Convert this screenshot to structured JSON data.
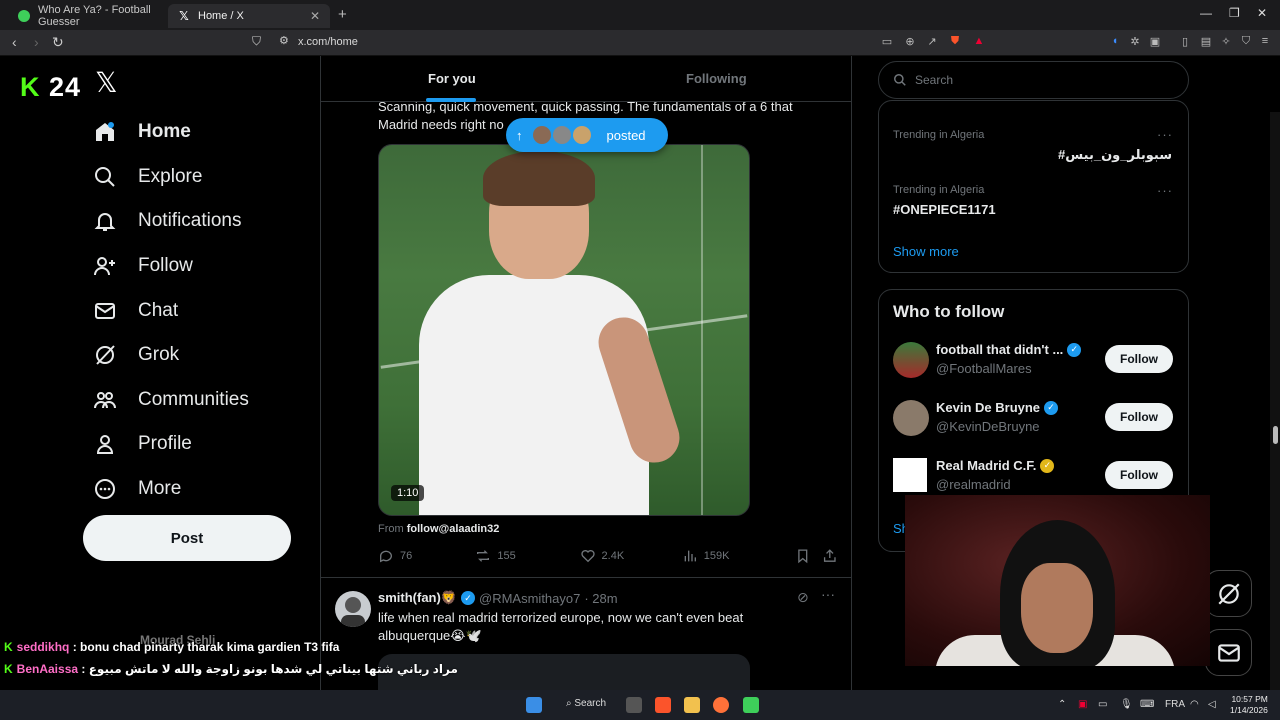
{
  "browser": {
    "tabs": [
      {
        "title": "Who Are Ya? - Football Guesser",
        "favicon": "globe-green-icon"
      },
      {
        "title": "Home / X",
        "favicon": "x-logo-icon"
      }
    ],
    "url": "x.com/home"
  },
  "overlay": {
    "channel_logo": "24"
  },
  "sidebar": {
    "items": [
      {
        "label": "Home",
        "icon": "home-icon"
      },
      {
        "label": "Explore",
        "icon": "search-icon"
      },
      {
        "label": "Notifications",
        "icon": "bell-icon"
      },
      {
        "label": "Follow",
        "icon": "person-add-icon"
      },
      {
        "label": "Chat",
        "icon": "mail-icon"
      },
      {
        "label": "Grok",
        "icon": "grok-icon"
      },
      {
        "label": "Communities",
        "icon": "people-icon"
      },
      {
        "label": "Profile",
        "icon": "person-icon"
      },
      {
        "label": "More",
        "icon": "more-circle-icon"
      }
    ],
    "post_label": "Post"
  },
  "feed": {
    "tabs": [
      "For you",
      "Following"
    ],
    "posted_pill": "posted",
    "tweet1": {
      "text_line1": "Scanning, quick movement, quick passing. The fundamentals of a 6 that",
      "text_line2": "Madrid needs right no",
      "duration": "1:10",
      "from_prefix": "From",
      "from_account": "follow@alaadin32",
      "replies": "76",
      "reposts": "155",
      "likes": "2.4K",
      "views": "159K"
    },
    "tweet2": {
      "name": "smith(fan)🦁",
      "handle": "@RMAsmithayo7",
      "time": "· 28m",
      "text_line1": "life when real madrid terrorized europe, now we can't even beat",
      "text_line2": "albuquerque😭🕊️"
    }
  },
  "right": {
    "search_placeholder": "Search",
    "trends": [
      {
        "meta": "Trending in Algeria",
        "name": "#سبوبلر_ون_بيس"
      },
      {
        "meta": "Trending in Algeria",
        "name": "#ONEPIECE1171"
      }
    ],
    "show_more": "Show more",
    "who_to_follow": {
      "title": "Who to follow",
      "accounts": [
        {
          "name": "football that didn't ...",
          "handle": "@FootballMares",
          "badge_color": "#1d9bf0"
        },
        {
          "name": "Kevin De Bruyne",
          "handle": "@KevinDeBruyne",
          "badge_color": "#1d9bf0"
        },
        {
          "name": "Real Madrid C.F.",
          "handle": "@realmadrid",
          "badge_color": "#e2b719"
        }
      ],
      "follow_label": "Follow"
    },
    "partial_show": "Sh"
  },
  "chat": [
    {
      "user": "seddikhq",
      "message": "bonu chad pinarty tharak kima gardien T3 fifa"
    },
    {
      "user": "BenAaissa",
      "message": "مراد رباني شتها بيناتي لي شدها بونو زاوجة والله لا ماتش مبيوع"
    }
  ],
  "ghost_name": "Mourad Sehli",
  "taskbar": {
    "search_label": "Search",
    "lang": "FRA",
    "time": "10:57 PM",
    "date": "1/14/2026"
  },
  "colors": {
    "accent": "#1d9bf0",
    "kick_green": "#53fc18",
    "background": "#000000"
  }
}
